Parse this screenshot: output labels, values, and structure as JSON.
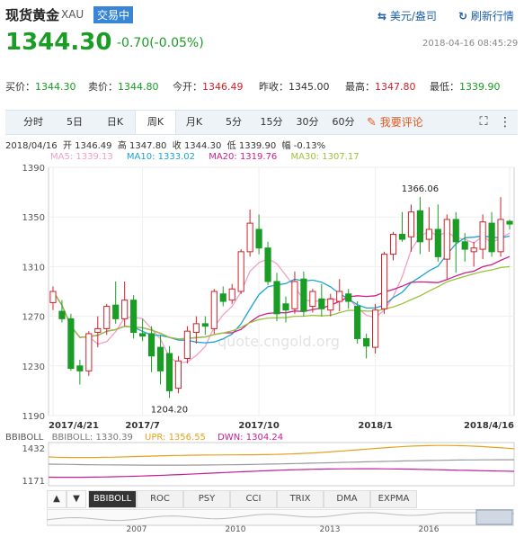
{
  "header": {
    "title": "现货黄金",
    "code": "XAU",
    "badge": "交易中",
    "currency_link": "美元/盎司",
    "refresh_link": "刷新行情"
  },
  "quote": {
    "price": "1344.30",
    "change": "-0.70(-0.05%)",
    "timestamp": "2018-04-16 08:45:29"
  },
  "stats": [
    {
      "label": "买价：",
      "value": "1344.30",
      "color": "green"
    },
    {
      "label": "卖价：",
      "value": "1344.80",
      "color": "green"
    },
    {
      "label": "今开：",
      "value": "1346.49",
      "color": "red"
    },
    {
      "label": "昨收：",
      "value": "1345.00",
      "color": "dark"
    },
    {
      "label": "最高：",
      "value": "1347.80",
      "color": "red"
    },
    {
      "label": "最低：",
      "value": "1339.90",
      "color": "green"
    }
  ],
  "tabs": [
    "分时",
    "5日",
    "日K",
    "周K",
    "月K",
    "5分",
    "15分",
    "30分",
    "60分"
  ],
  "active_tab": "周K",
  "comment_button": "我要评论",
  "ohlc_line": "2018/04/16  开 1346.49  高 1347.80  收 1344.30  低 1339.90  幅 -0.13%",
  "ma_legend": [
    {
      "label": "MA5: 1339.13",
      "color": "#f29fc5"
    },
    {
      "label": "MA10: 1333.02",
      "color": "#1aa3d6"
    },
    {
      "label": "MA20: 1319.76",
      "color": "#cc1f8a"
    },
    {
      "label": "MA30: 1307.17",
      "color": "#9bc23c"
    }
  ],
  "watermark": "quote.cngold.org",
  "boll_legend": [
    {
      "label": "BBIBOLL",
      "color": "#555"
    },
    {
      "label": "BBIBOLL: 1330.39",
      "color": "#777"
    },
    {
      "label": "UPR: 1356.55",
      "color": "#e7a21b"
    },
    {
      "label": "DWN: 1304.24",
      "color": "#c21d9a"
    }
  ],
  "bottom_tabs": [
    "BBIBOLL",
    "ROC",
    "PSY",
    "CCI",
    "TRIX",
    "DMA",
    "EXPMA"
  ],
  "active_bottom_tab": "BBIBOLL",
  "nav_arrows": [
    "▲",
    "▼"
  ],
  "timeline_years": [
    "2007",
    "2010",
    "2013",
    "2016"
  ],
  "chart_data": {
    "type": "candlestick",
    "title": "",
    "y_ticks": [
      1390,
      1350,
      1310,
      1270,
      1230,
      1190
    ],
    "ylim": [
      1190,
      1390
    ],
    "x_tick_labels": [
      "2017/4/21",
      "2017/7",
      "2017/10",
      "2018/1",
      "2018/4/16"
    ],
    "annotations": [
      {
        "text": "1366.06",
        "value": 1366.06,
        "type": "high"
      },
      {
        "text": "1204.20",
        "value": 1204.2,
        "type": "low"
      }
    ],
    "weeks": 52,
    "candles": [
      {
        "o": 1281,
        "h": 1294,
        "l": 1275,
        "c": 1290
      },
      {
        "o": 1274,
        "h": 1283,
        "l": 1265,
        "c": 1268
      },
      {
        "o": 1268,
        "h": 1272,
        "l": 1226,
        "c": 1228
      },
      {
        "o": 1230,
        "h": 1235,
        "l": 1215,
        "c": 1226
      },
      {
        "o": 1226,
        "h": 1258,
        "l": 1222,
        "c": 1256
      },
      {
        "o": 1257,
        "h": 1270,
        "l": 1245,
        "c": 1260
      },
      {
        "o": 1260,
        "h": 1280,
        "l": 1255,
        "c": 1278
      },
      {
        "o": 1279,
        "h": 1298,
        "l": 1264,
        "c": 1268
      },
      {
        "o": 1268,
        "h": 1298,
        "l": 1262,
        "c": 1283
      },
      {
        "o": 1283,
        "h": 1287,
        "l": 1252,
        "c": 1257
      },
      {
        "o": 1256,
        "h": 1268,
        "l": 1250,
        "c": 1254
      },
      {
        "o": 1256,
        "h": 1262,
        "l": 1225,
        "c": 1238
      },
      {
        "o": 1245,
        "h": 1255,
        "l": 1215,
        "c": 1226
      },
      {
        "o": 1240,
        "h": 1246,
        "l": 1204.2,
        "c": 1210
      },
      {
        "o": 1212,
        "h": 1238,
        "l": 1208,
        "c": 1234
      },
      {
        "o": 1236,
        "h": 1262,
        "l": 1232,
        "c": 1258
      },
      {
        "o": 1257,
        "h": 1270,
        "l": 1248,
        "c": 1264
      },
      {
        "o": 1264,
        "h": 1270,
        "l": 1255,
        "c": 1262
      },
      {
        "o": 1260,
        "h": 1292,
        "l": 1256,
        "c": 1290
      },
      {
        "o": 1288,
        "h": 1294,
        "l": 1278,
        "c": 1282
      },
      {
        "o": 1283,
        "h": 1296,
        "l": 1280,
        "c": 1292
      },
      {
        "o": 1290,
        "h": 1324,
        "l": 1288,
        "c": 1322
      },
      {
        "o": 1322,
        "h": 1356,
        "l": 1318,
        "c": 1345
      },
      {
        "o": 1340,
        "h": 1352,
        "l": 1320,
        "c": 1325
      },
      {
        "o": 1325,
        "h": 1330,
        "l": 1295,
        "c": 1298
      },
      {
        "o": 1298,
        "h": 1305,
        "l": 1266,
        "c": 1272
      },
      {
        "o": 1280,
        "h": 1286,
        "l": 1265,
        "c": 1275
      },
      {
        "o": 1276,
        "h": 1306,
        "l": 1272,
        "c": 1298
      },
      {
        "o": 1300,
        "h": 1306,
        "l": 1270,
        "c": 1274
      },
      {
        "o": 1278,
        "h": 1292,
        "l": 1273,
        "c": 1290
      },
      {
        "o": 1284,
        "h": 1296,
        "l": 1270,
        "c": 1276
      },
      {
        "o": 1275,
        "h": 1288,
        "l": 1270,
        "c": 1284
      },
      {
        "o": 1282,
        "h": 1300,
        "l": 1274,
        "c": 1290
      },
      {
        "o": 1288,
        "h": 1292,
        "l": 1276,
        "c": 1282
      },
      {
        "o": 1278,
        "h": 1282,
        "l": 1248,
        "c": 1252
      },
      {
        "o": 1252,
        "h": 1256,
        "l": 1236,
        "c": 1246
      },
      {
        "o": 1245,
        "h": 1280,
        "l": 1240,
        "c": 1275
      },
      {
        "o": 1276,
        "h": 1322,
        "l": 1272,
        "c": 1320
      },
      {
        "o": 1320,
        "h": 1338,
        "l": 1315,
        "c": 1336
      },
      {
        "o": 1336,
        "h": 1354,
        "l": 1330,
        "c": 1332
      },
      {
        "o": 1334,
        "h": 1360,
        "l": 1322,
        "c": 1354
      },
      {
        "o": 1355,
        "h": 1366.06,
        "l": 1320,
        "c": 1330
      },
      {
        "o": 1332,
        "h": 1358,
        "l": 1322,
        "c": 1340
      },
      {
        "o": 1340,
        "h": 1360,
        "l": 1314,
        "c": 1318
      },
      {
        "o": 1316,
        "h": 1352,
        "l": 1300,
        "c": 1348
      },
      {
        "o": 1348,
        "h": 1354,
        "l": 1305,
        "c": 1330
      },
      {
        "o": 1330,
        "h": 1337,
        "l": 1314,
        "c": 1324
      },
      {
        "o": 1322,
        "h": 1330,
        "l": 1310,
        "c": 1325
      },
      {
        "o": 1324,
        "h": 1352,
        "l": 1316,
        "c": 1346
      },
      {
        "o": 1345,
        "h": 1354,
        "l": 1318,
        "c": 1322
      },
      {
        "o": 1322,
        "h": 1366,
        "l": 1318,
        "c": 1348
      },
      {
        "o": 1346.49,
        "h": 1347.8,
        "l": 1339.9,
        "c": 1344.3
      }
    ]
  }
}
